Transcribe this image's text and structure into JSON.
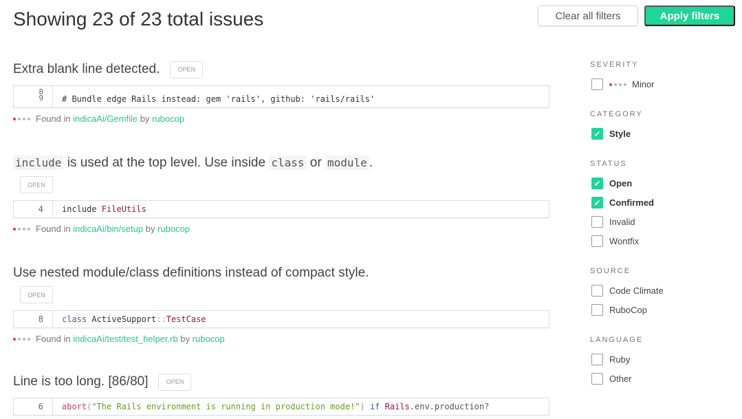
{
  "header": {
    "title": "Showing 23 of 23 total issues",
    "clear_label": "Clear all filters",
    "apply_label": "Apply filters"
  },
  "colors": {
    "accent": "#1ed59a",
    "severity": "#e0365c"
  },
  "issues": [
    {
      "title_parts": [
        {
          "t": "Extra blank line detected."
        }
      ],
      "status": "OPEN",
      "line": "8\n9",
      "code": [
        {
          "t": "# Bundle edge Rails instead: gem 'rails', github: 'rails/rails'",
          "c": "#333"
        }
      ],
      "found": "Found in",
      "path": "indicaAi/Gemfile",
      "by": "by",
      "tool": "rubocop"
    },
    {
      "title_parts": [
        {
          "t": "include",
          "code": true
        },
        {
          "t": " is used at the top level. Use inside "
        },
        {
          "t": "class",
          "code": true
        },
        {
          "t": " or "
        },
        {
          "t": "module",
          "code": true
        },
        {
          "t": "."
        }
      ],
      "status": "OPEN",
      "line": "4",
      "code": [
        {
          "t": "include ",
          "c": "#333"
        },
        {
          "t": "FileUtils",
          "c": "#a0124a"
        }
      ],
      "found": "Found in",
      "path": "indicaAi/bin/setup",
      "by": "by",
      "tool": "rubocop"
    },
    {
      "title_parts": [
        {
          "t": "Use nested module/class definitions instead of compact style."
        }
      ],
      "status": "OPEN",
      "line": "8",
      "code": [
        {
          "t": "class ",
          "c": "#3465a4"
        },
        {
          "t": "ActiveSupport",
          "c": "#333"
        },
        {
          "t": "::",
          "c": "#999"
        },
        {
          "t": "TestCase",
          "c": "#a0124a"
        }
      ],
      "found": "Found in",
      "path": "indicaAi/test/test_helper.rb",
      "by": "by",
      "tool": "rubocop"
    },
    {
      "title_parts": [
        {
          "t": "Line is too long. [86/80]"
        }
      ],
      "status": "OPEN",
      "line": "6",
      "code": [
        {
          "t": "abort",
          "c": "#d6336c"
        },
        {
          "t": "(",
          "c": "#999"
        },
        {
          "t": "\"The Rails environment is running in production mode!\"",
          "c": "#6a9a1f"
        },
        {
          "t": ") ",
          "c": "#999"
        },
        {
          "t": "if ",
          "c": "#3465a4"
        },
        {
          "t": "Rails",
          "c": "#a0124a"
        },
        {
          "t": ".env.production?",
          "c": "#555"
        }
      ]
    }
  ],
  "filters": {
    "severity": {
      "label": "SEVERITY",
      "items": [
        {
          "label": "Minor",
          "checked": false
        }
      ]
    },
    "category": {
      "label": "CATEGORY",
      "items": [
        {
          "label": "Style",
          "checked": true
        }
      ]
    },
    "status": {
      "label": "STATUS",
      "items": [
        {
          "label": "Open",
          "checked": true
        },
        {
          "label": "Confirmed",
          "checked": true
        },
        {
          "label": "Invalid",
          "checked": false
        },
        {
          "label": "Wontfix",
          "checked": false
        }
      ]
    },
    "source": {
      "label": "SOURCE",
      "items": [
        {
          "label": "Code Climate",
          "checked": false
        },
        {
          "label": "RuboCop",
          "checked": false
        }
      ]
    },
    "language": {
      "label": "LANGUAGE",
      "items": [
        {
          "label": "Ruby",
          "checked": false
        },
        {
          "label": "Other",
          "checked": false
        }
      ]
    }
  }
}
